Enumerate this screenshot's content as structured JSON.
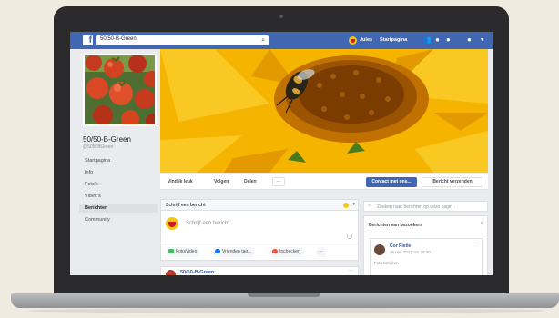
{
  "topbar": {
    "search_value": "50/50-B-Green",
    "user_name": "Jules",
    "home_label": "Startpagina",
    "accent_color": "#4267b2"
  },
  "page": {
    "name": "50/50-B-Green",
    "handle": "@5050BGreen"
  },
  "nav": {
    "items": [
      {
        "label": "Startpagina"
      },
      {
        "label": "Info"
      },
      {
        "label": "Foto's"
      },
      {
        "label": "Video's"
      },
      {
        "label": "Berichten",
        "active": true
      },
      {
        "label": "Community"
      }
    ]
  },
  "actions": {
    "like": "Vind ik leuk",
    "follow": "Volgen",
    "share": "Delen",
    "more": "···",
    "contact": "Contact met ons...",
    "message": "Bericht verzenden"
  },
  "composer": {
    "title": "Schrijf een bericht",
    "placeholder": "Schrijf een bericht",
    "photo_video": "Foto/video",
    "tag_friends": "Vrienden tag...",
    "check_in": "Inchecken",
    "more": "···"
  },
  "post": {
    "author": "50/50-B-Green",
    "more": "···"
  },
  "right": {
    "page_search_placeholder": "Zoeken naar berichten op deze pagin",
    "visitors_title": "Berichten van bezoekers",
    "visitor_name": "Cor Pietie",
    "visitor_time": "16 mei 2017 om 20:30",
    "visitor_sub": "Foto bekijken",
    "visitor_more": "···"
  }
}
